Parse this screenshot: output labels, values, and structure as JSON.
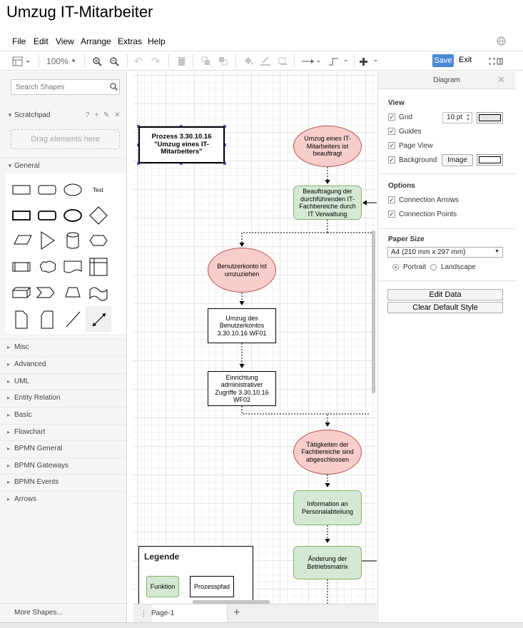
{
  "title": "Umzug IT-Mitarbeiter",
  "menu": [
    "File",
    "Edit",
    "View",
    "Arrange",
    "Extras",
    "Help"
  ],
  "toolbar": {
    "zoom": "100%",
    "save": "Save",
    "exit": "Exit"
  },
  "sidebar": {
    "search_placeholder": "Search Shapes",
    "scratchpad": "Scratchpad",
    "scratchpad_tools": "? + ✎ ✕",
    "drag_hint": "Drag elements here",
    "general": "General",
    "text_shape": "Text",
    "sections": [
      "Misc",
      "Advanced",
      "UML",
      "Entity Relation",
      "Basic",
      "Flowchart",
      "BPMN General",
      "BPMN Gateways",
      "BPMN Events",
      "Arrows"
    ],
    "more_shapes": "More Shapes..."
  },
  "diagram": {
    "nodes": [
      {
        "id": "n1",
        "type": "title-box",
        "text": "Prozess 3.30.10.16 \"Umzug eines IT-Mitarbeiters\""
      },
      {
        "id": "n2",
        "type": "event",
        "text": "Umzug eines IT-Mitarbeiters ist beauftragt"
      },
      {
        "id": "n3",
        "type": "function",
        "text": "Beauftragung der durchführenden IT-Fachbereiche durch IT Verwaltung"
      },
      {
        "id": "n4",
        "type": "event",
        "text": "Benutzerkonto ist umzuziehen"
      },
      {
        "id": "n5",
        "type": "process",
        "text": "Umzug des Benutzerkontos 3.30.10.16 WF01"
      },
      {
        "id": "n6",
        "type": "process",
        "text": "Einrichtung administrativer Zugriffe 3.30.10.16 WF02"
      },
      {
        "id": "n7",
        "type": "event",
        "text": "Tätigkeiten der Fachbereiche sind abgeschlossen"
      },
      {
        "id": "n8",
        "type": "function",
        "text": "Information an Personalabteilung"
      },
      {
        "id": "n9",
        "type": "function",
        "text": "Änderung der Betriebsmatrix"
      }
    ],
    "legend": {
      "title": "Legende",
      "function": "Funktion",
      "process_path": "Prozesspfad"
    },
    "page_tab": "Page-1"
  },
  "format_panel": {
    "tab": "Diagram",
    "view_title": "View",
    "grid": "Grid",
    "grid_size": "10 pt",
    "guides": "Guides",
    "page_view": "Page View",
    "background": "Background",
    "image_button": "Image",
    "options_title": "Options",
    "connection_arrows": "Connection Arrows",
    "connection_points": "Connection Points",
    "paper_size_title": "Paper Size",
    "paper_size": "A4 (210 mm x 297 mm)",
    "portrait": "Portrait",
    "landscape": "Landscape",
    "edit_data": "Edit Data",
    "clear_default_style": "Clear Default Style"
  },
  "colors": {
    "event_fill": "#f8cecc",
    "function_fill": "#d5e8d4",
    "save": "#4a8ad4"
  }
}
